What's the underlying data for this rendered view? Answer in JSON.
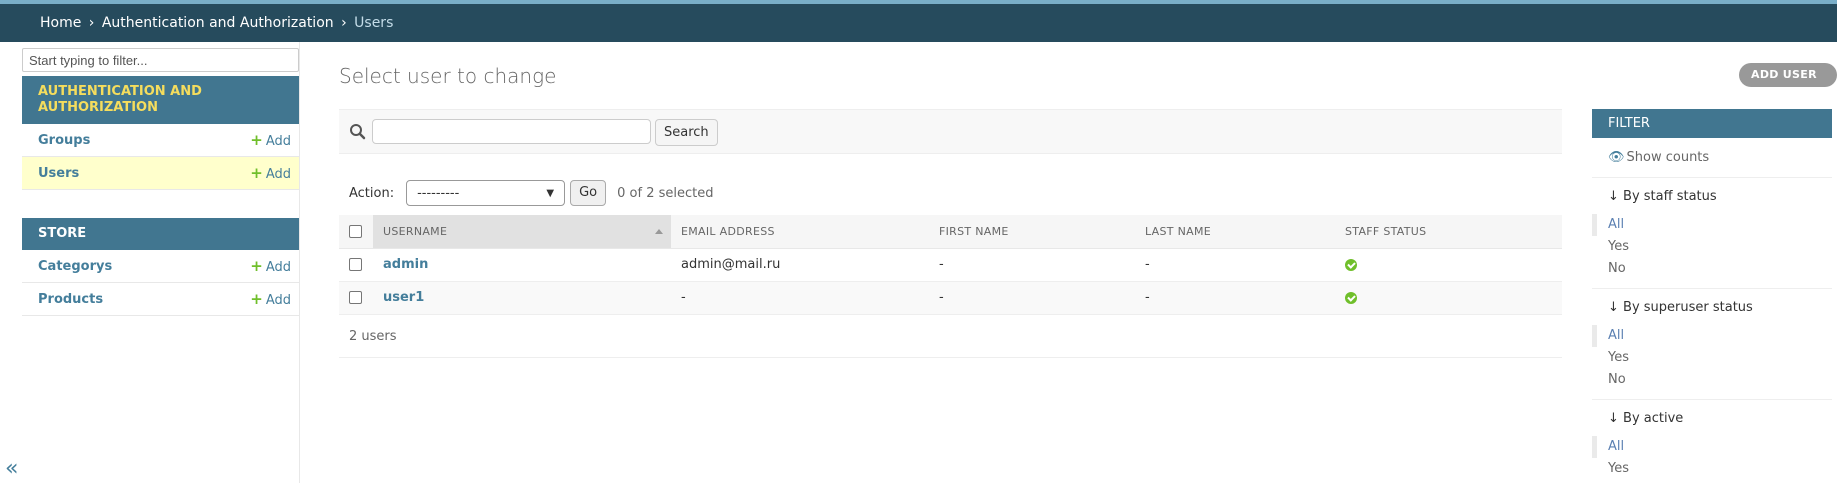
{
  "breadcrumbs": {
    "home": "Home",
    "app": "Authentication and Authorization",
    "current": "Users",
    "sep": "›"
  },
  "sidebar": {
    "filter_placeholder": "Start typing to filter...",
    "modules": [
      {
        "caption": "AUTHENTICATION AND AUTHORIZATION",
        "models": [
          {
            "name": "Groups",
            "add": "Add"
          },
          {
            "name": "Users",
            "add": "Add"
          }
        ]
      },
      {
        "caption": "STORE",
        "models": [
          {
            "name": "Categorys",
            "add": "Add"
          },
          {
            "name": "Products",
            "add": "Add"
          }
        ]
      }
    ],
    "collapse": "«"
  },
  "content": {
    "title": "Select user to change",
    "add_user": "ADD USER",
    "search_button": "Search",
    "action_label": "Action:",
    "action_value": "---------",
    "go": "Go",
    "selected": "0 of 2 selected",
    "columns": [
      "USERNAME",
      "EMAIL ADDRESS",
      "FIRST NAME",
      "LAST NAME",
      "STAFF STATUS"
    ],
    "rows": [
      {
        "username": "admin",
        "email": "admin@mail.ru",
        "first": "-",
        "last": "-",
        "staff": true
      },
      {
        "username": "user1",
        "email": "-",
        "first": "-",
        "last": "-",
        "staff": true
      }
    ],
    "count": "2 users"
  },
  "filter": {
    "title": "FILTER",
    "show_counts": "Show counts",
    "groups": [
      {
        "title": "↓ By staff status",
        "options": [
          "All",
          "Yes",
          "No"
        ]
      },
      {
        "title": "↓ By superuser status",
        "options": [
          "All",
          "Yes",
          "No"
        ]
      },
      {
        "title": "↓ By active",
        "options": [
          "All",
          "Yes"
        ]
      }
    ]
  },
  "colors": {
    "header": "#264b5d",
    "module": "#417690",
    "link": "#447e9b",
    "add": "#70bf2b",
    "current_row": "#ffffcc"
  }
}
